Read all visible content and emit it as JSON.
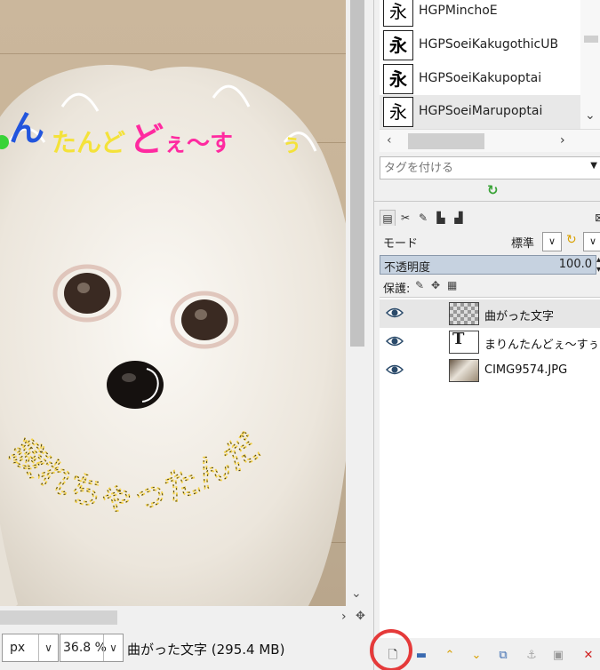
{
  "canvas": {
    "overlay_text_top": "ñまりんたんどぇ〜すぅ",
    "overlay_text_top_visible": "んたんどぇ〜すぅ",
    "overlay_text_curved": "疲れちゃったんだ？",
    "image_description_colors": {
      "floor": "#c9b599",
      "dog": "#f2eee8"
    }
  },
  "statusbar": {
    "unit": "px",
    "zoom": "36.8 %",
    "status": "曲がった文字 (295.4 MB)"
  },
  "fonts": {
    "items": [
      {
        "glyph": "永",
        "name": "HGPMinchoE"
      },
      {
        "glyph": "永",
        "name": "HGPSoeiKakugothicUB"
      },
      {
        "glyph": "永",
        "name": "HGPSoeiKakupoptai"
      },
      {
        "glyph": "永",
        "name": "HGPSoeiMarupoptai"
      }
    ],
    "tag_placeholder": "タグを付ける"
  },
  "layers_panel": {
    "mode_label": "モード",
    "mode_value": "標準",
    "opacity_label": "不透明度",
    "opacity_value": "100.0",
    "lock_label": "保護:",
    "layers": [
      {
        "name": "曲がった文字",
        "thumb": "checker"
      },
      {
        "name": "まりんたんどぇ〜すぅ",
        "thumb": "text"
      },
      {
        "name": "CIMG9574.JPG",
        "thumb": "photo"
      }
    ]
  },
  "accent_colors": {
    "highlight_ring": "#e53a3a",
    "selection": "#c6d2e0"
  }
}
